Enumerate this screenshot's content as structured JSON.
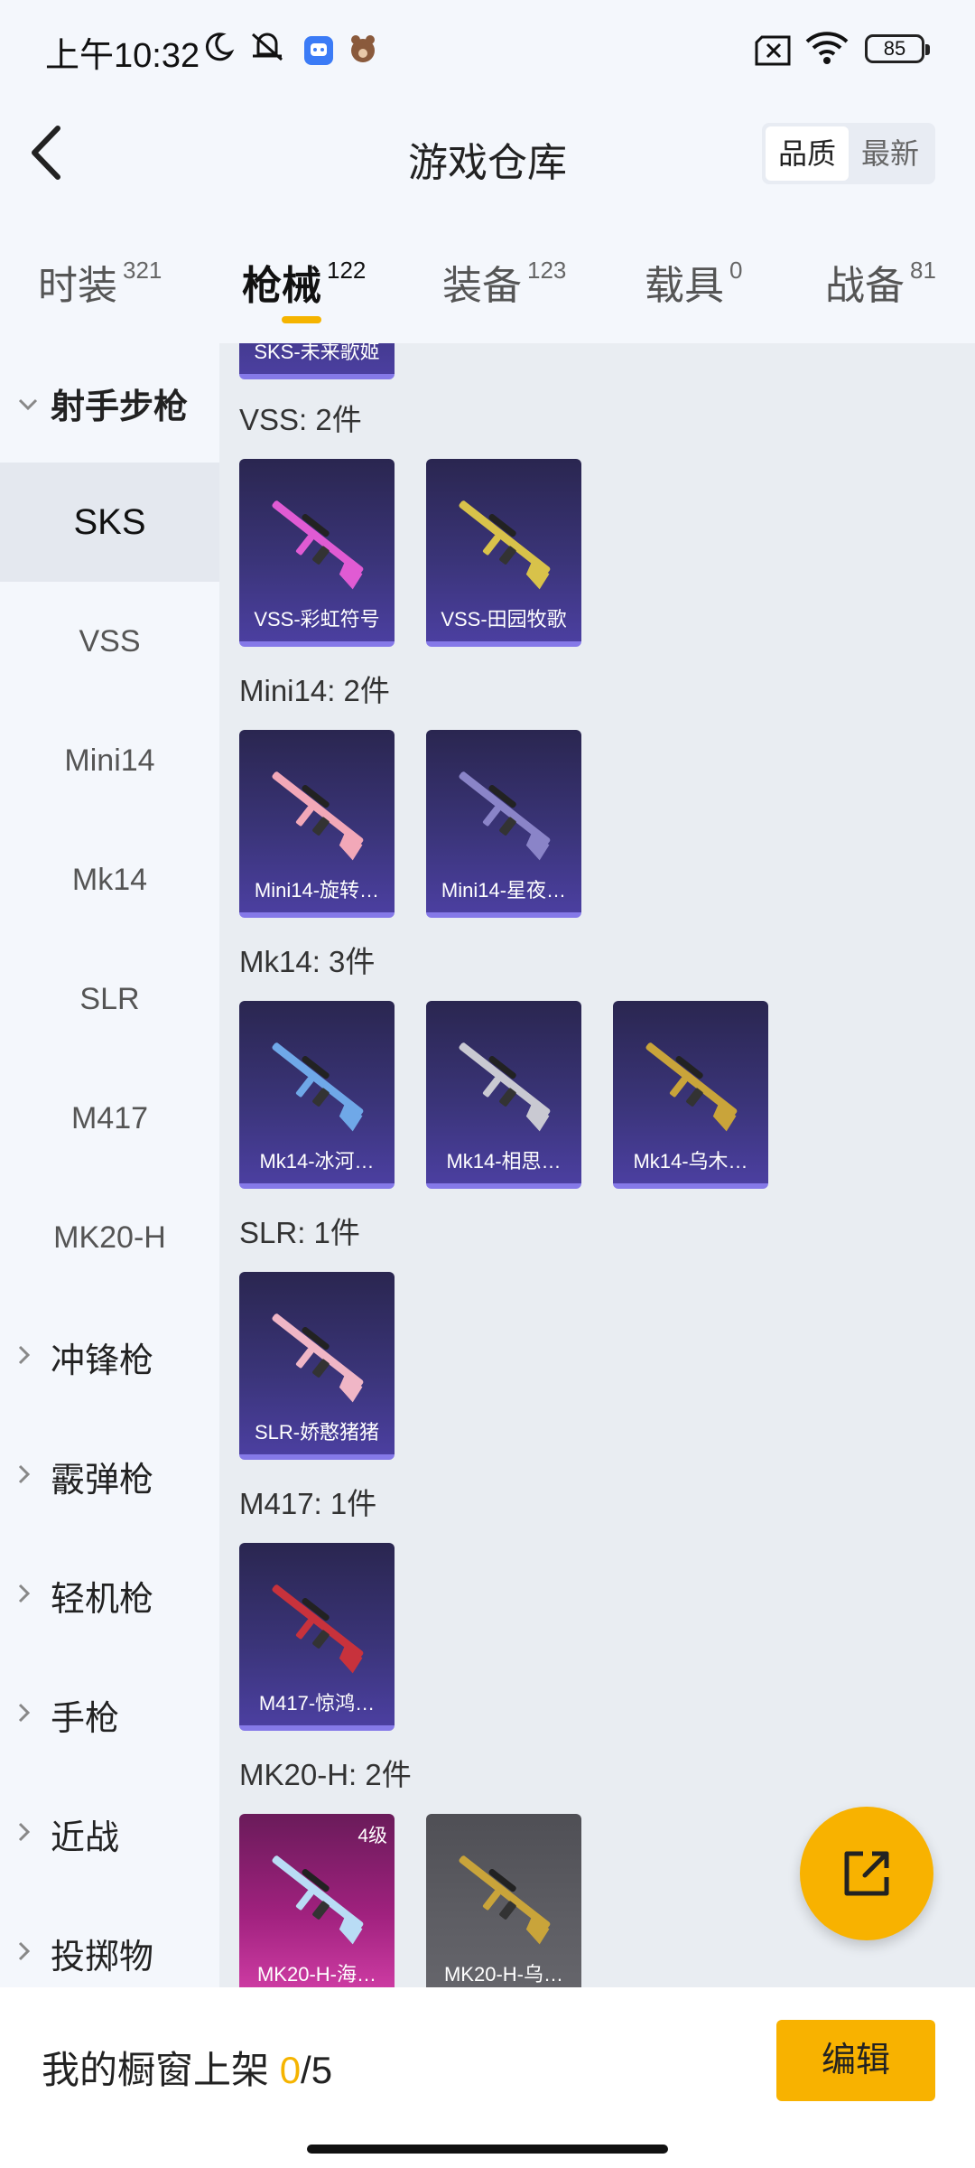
{
  "status_bar": {
    "time": "上午10:32",
    "battery": "85",
    "icons": [
      "moon-icon",
      "notifications-muted-icon",
      "app-notification-icon",
      "avatar-notification-icon",
      "sim-no-signal-icon",
      "wifi-icon",
      "battery-icon"
    ]
  },
  "header": {
    "title": "游戏仓库",
    "sort_options": [
      "品质",
      "最新"
    ],
    "sort_selected": "品质"
  },
  "tabs": [
    {
      "label": "时装",
      "count": "321"
    },
    {
      "label": "枪械",
      "count": "122"
    },
    {
      "label": "装备",
      "count": "123"
    },
    {
      "label": "载具",
      "count": "0"
    },
    {
      "label": "战备",
      "count": "81"
    }
  ],
  "active_tab": "枪械",
  "sidebar": {
    "open_category": "射手步枪",
    "sub_items": [
      "SKS",
      "VSS",
      "Mini14",
      "Mk14",
      "SLR",
      "M417",
      "MK20-H"
    ],
    "active_sub_item": "SKS",
    "categories": [
      "冲锋枪",
      "霰弹枪",
      "轻机枪",
      "手枪",
      "近战",
      "投掷物"
    ]
  },
  "content": {
    "partial_top_item": "SKS-未来歌姬",
    "sections": [
      {
        "label": "VSS: 2件",
        "items": [
          {
            "name": "VSS-彩虹符号",
            "style": "purple",
            "accent": "#e05bd3"
          },
          {
            "name": "VSS-田园牧歌",
            "style": "purple",
            "accent": "#d8c24a"
          }
        ]
      },
      {
        "label": "Mini14: 2件",
        "items": [
          {
            "name": "Mini14-旋转…",
            "style": "purple",
            "accent": "#f2a8b8"
          },
          {
            "name": "Mini14-星夜…",
            "style": "purple",
            "accent": "#8a84c8"
          }
        ]
      },
      {
        "label": "Mk14: 3件",
        "items": [
          {
            "name": "Mk14-冰河…",
            "style": "purple",
            "accent": "#6fa8e8"
          },
          {
            "name": "Mk14-相思…",
            "style": "purple",
            "accent": "#c9c9d2"
          },
          {
            "name": "Mk14-乌木…",
            "style": "purple",
            "accent": "#c9a43a"
          }
        ]
      },
      {
        "label": "SLR: 1件",
        "items": [
          {
            "name": "SLR-娇憨猪猪",
            "style": "purple",
            "accent": "#f0b6c6"
          }
        ]
      },
      {
        "label": "M417: 1件",
        "items": [
          {
            "name": "M417-惊鸿…",
            "style": "purple",
            "accent": "#c8323c"
          }
        ]
      },
      {
        "label": "MK20-H: 2件",
        "items": [
          {
            "name": "MK20-H-海…",
            "style": "pink",
            "accent": "#b9dcf5",
            "level": "4级"
          },
          {
            "name": "MK20-H-乌…",
            "style": "gray",
            "accent": "#c9a43a"
          }
        ]
      }
    ]
  },
  "bottom": {
    "showcase_label": "我的橱窗上架",
    "showcase_count": "0",
    "showcase_total": "/5",
    "edit_label": "编辑"
  },
  "colors": {
    "accent": "#f8b200",
    "background": "#f4f7fc",
    "content_bg": "#e9edf2"
  }
}
